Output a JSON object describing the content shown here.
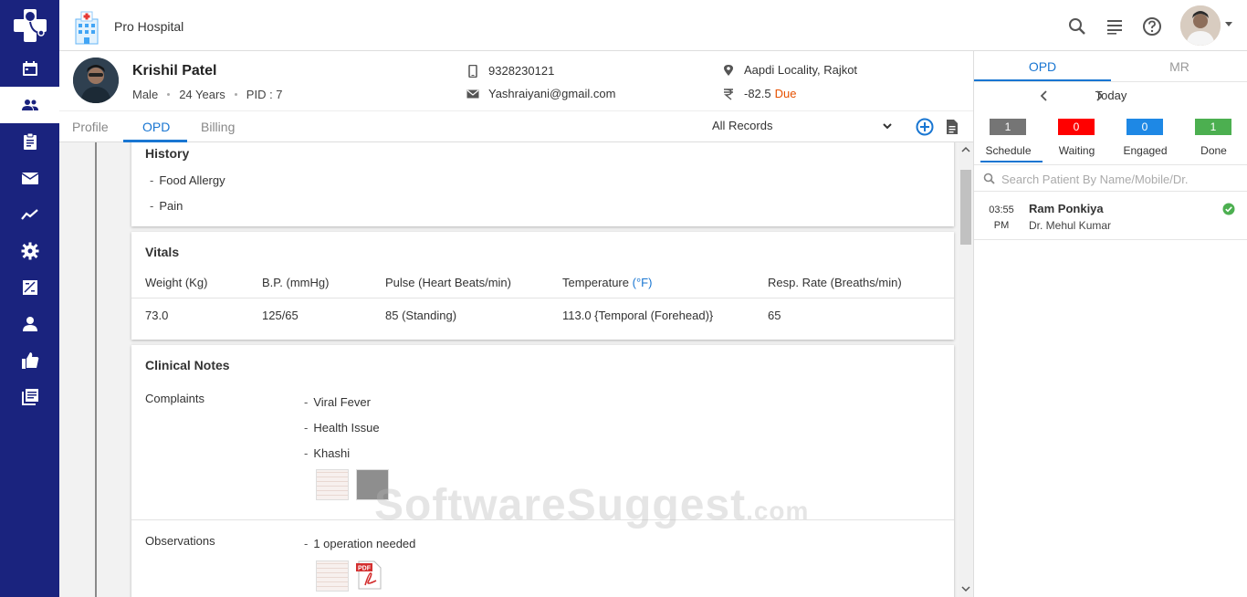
{
  "app": {
    "hospital_name": "Pro Hospital"
  },
  "nav": {
    "items": [
      {
        "icon": "calendar-icon"
      },
      {
        "icon": "patients-icon",
        "active": true
      },
      {
        "icon": "clipboard-icon"
      },
      {
        "icon": "mail-icon"
      },
      {
        "icon": "trend-icon"
      },
      {
        "icon": "gear-icon"
      },
      {
        "icon": "report-icon"
      },
      {
        "icon": "user-icon"
      },
      {
        "icon": "thumbs-up-icon"
      },
      {
        "icon": "library-icon"
      }
    ]
  },
  "patient": {
    "name": "Krishil Patel",
    "gender": "Male",
    "age": "24 Years",
    "pid": "PID : 7",
    "phone": "9328230121",
    "email": "Yashraiyani@gmail.com",
    "address": "Aapdi Locality, Rajkot",
    "balance": "-82.5",
    "balance_status": "Due"
  },
  "tabs": {
    "profile": "Profile",
    "opd": "OPD",
    "billing": "Billing",
    "records_filter": "All Records"
  },
  "history": {
    "title": "History",
    "items": [
      "Food Allergy",
      "Pain"
    ]
  },
  "vitals": {
    "title": "Vitals",
    "headers": {
      "weight": "Weight (Kg)",
      "bp": "B.P. (mmHg)",
      "pulse": "Pulse (Heart Beats/min)",
      "temperature": "Temperature",
      "temperature_unit": "(°F)",
      "resp": "Resp. Rate (Breaths/min)"
    },
    "values": {
      "weight": "73.0",
      "bp": "125/65",
      "pulse": "85 (Standing)",
      "temperature": "113.0 {Temporal (Forehead)}",
      "resp": "65"
    }
  },
  "clinical_notes": {
    "title": "Clinical Notes",
    "complaints_label": "Complaints",
    "complaints": [
      "Viral Fever",
      "Health Issue",
      "Khashi"
    ],
    "observations_label": "Observations",
    "observations": [
      "1 operation needed"
    ]
  },
  "right_panel": {
    "tab_opd": "OPD",
    "tab_mr": "MR",
    "date_label": "Today",
    "counters": [
      {
        "label": "Schedule",
        "count": "1",
        "color": "#757575"
      },
      {
        "label": "Waiting",
        "count": "0",
        "color": "#ff0000"
      },
      {
        "label": "Engaged",
        "count": "0",
        "color": "#1e88e5"
      },
      {
        "label": "Done",
        "count": "1",
        "color": "#4caf50"
      }
    ],
    "search_placeholder": "Search Patient By Name/Mobile/Dr.",
    "appointments": [
      {
        "time": "03:55",
        "period": "PM",
        "patient": "Ram Ponkiya",
        "doctor": "Dr. Mehul Kumar"
      }
    ]
  },
  "watermark": {
    "main": "SoftwareSuggest",
    "suffix": ".com"
  },
  "colors": {
    "nav_bg": "#1a237e",
    "accent": "#1976d2",
    "due": "#e65100"
  }
}
